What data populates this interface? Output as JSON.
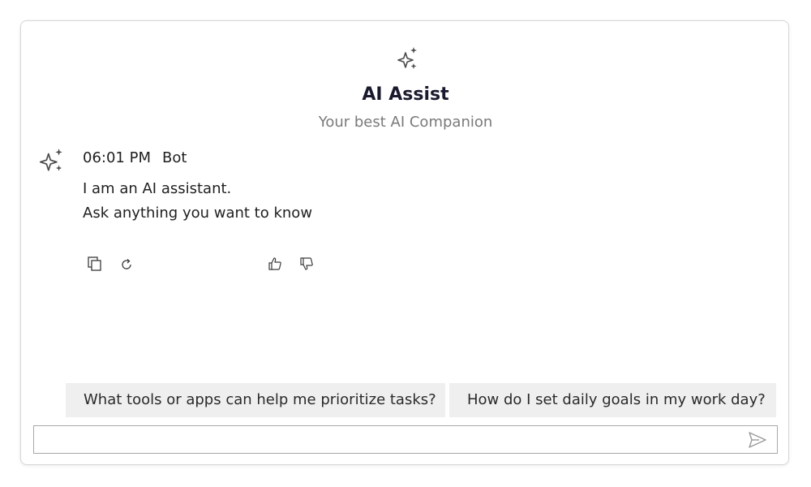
{
  "header": {
    "icon": "sparkle-icon",
    "title": "AI Assist",
    "subtitle": "Your best AI Companion"
  },
  "message": {
    "avatar_icon": "sparkle-icon",
    "time": "06:01 PM",
    "author": "Bot",
    "lines": [
      "I am an AI assistant.",
      "Ask anything you want to know"
    ],
    "actions": [
      "copy-icon",
      "regenerate-icon",
      "thumbs-up-icon",
      "thumbs-down-icon"
    ]
  },
  "suggestions": [
    "What tools or apps can help me prioritize tasks?",
    "How do I set daily goals in my work day?"
  ],
  "composer": {
    "value": "",
    "placeholder": "",
    "send_icon": "send-icon"
  }
}
